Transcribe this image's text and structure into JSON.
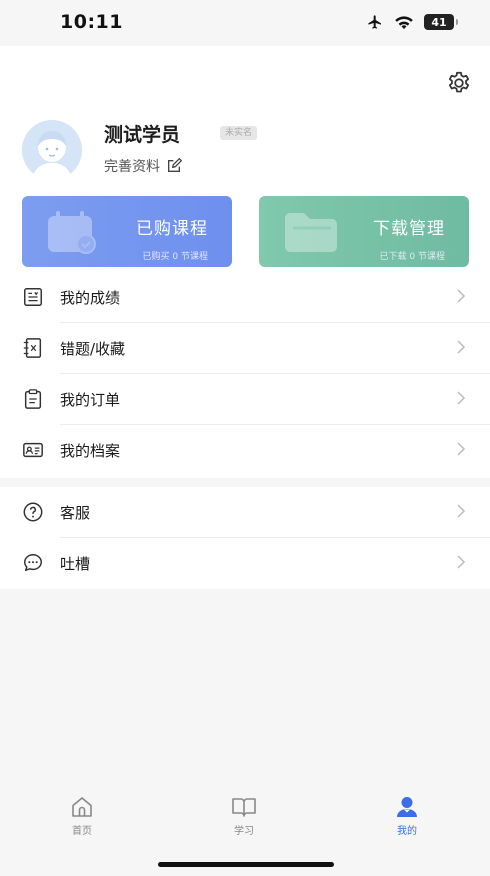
{
  "status_bar": {
    "time": "10:11",
    "battery": "41"
  },
  "profile": {
    "name": "测试学员",
    "badge": "未实名",
    "edit_label": "完善资料"
  },
  "quick_cards": {
    "purchased": {
      "title": "已购课程",
      "subtitle": "已购买 0 节课程"
    },
    "downloads": {
      "title": "下载管理",
      "subtitle": "已下载 0 节课程"
    }
  },
  "menu": [
    {
      "label": "我的成绩",
      "icon": "score-icon"
    },
    {
      "label": "错题/收藏",
      "icon": "notebook-icon"
    },
    {
      "label": "我的订单",
      "icon": "clipboard-icon"
    },
    {
      "label": "我的档案",
      "icon": "id-card-icon"
    }
  ],
  "service": [
    {
      "label": "客服",
      "icon": "help-icon"
    },
    {
      "label": "吐槽",
      "icon": "chat-icon"
    }
  ],
  "tabs": [
    {
      "label": "首页",
      "icon": "home-icon"
    },
    {
      "label": "学习",
      "icon": "book-icon"
    },
    {
      "label": "我的",
      "icon": "person-icon"
    }
  ],
  "colors": {
    "accent": "#3b6ee8",
    "purchased_card": "#7d9df0",
    "downloads_card": "#80c8ae"
  }
}
